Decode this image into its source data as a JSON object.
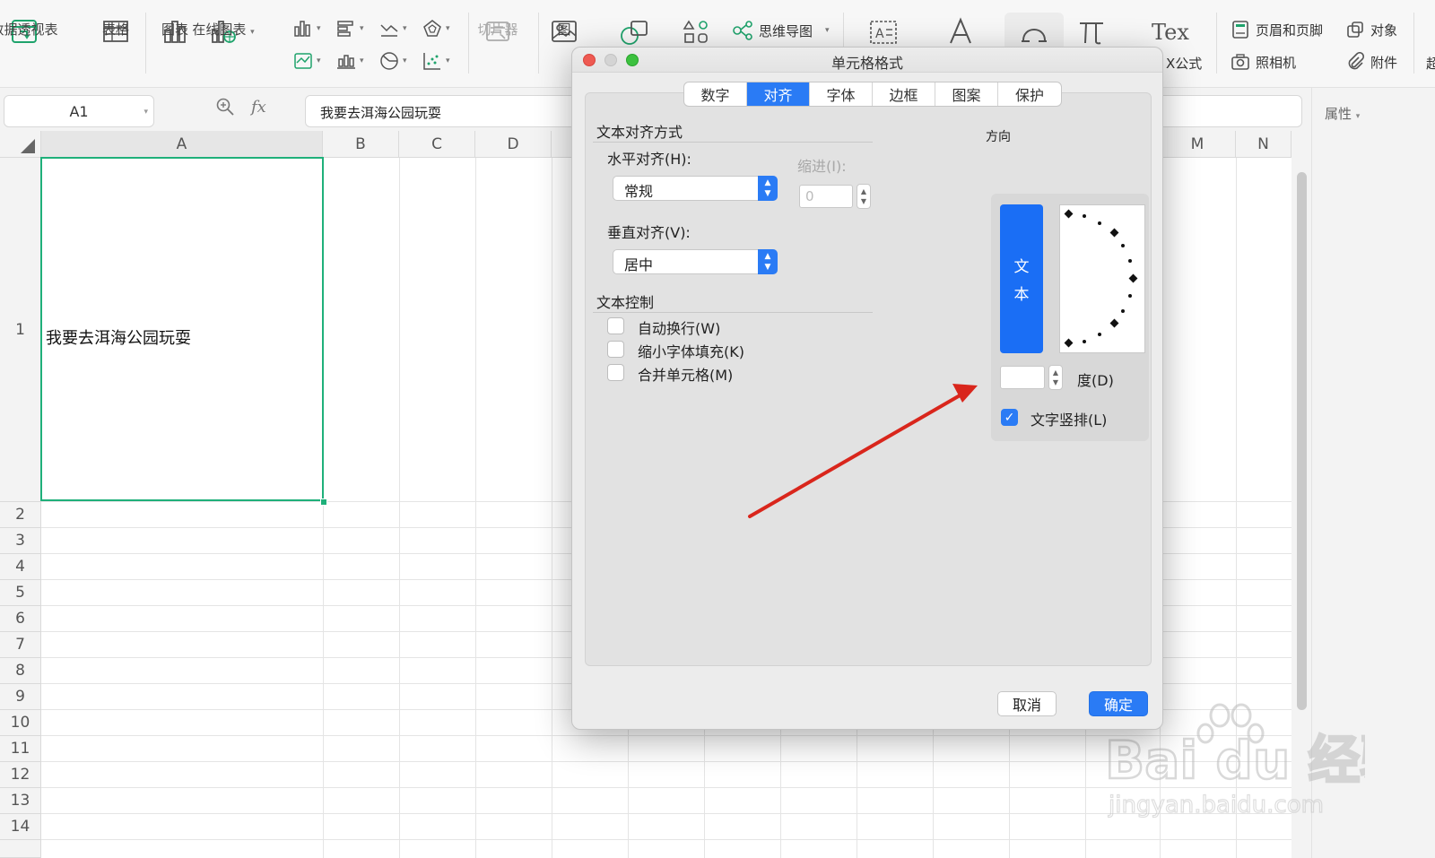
{
  "toolbar": {
    "pivot_table": "数据透视表",
    "table": "表格",
    "chart": "图表",
    "online_chart": "在线图表",
    "slicer": "切片器",
    "picture_partial": "图",
    "mind_map": "思维导图",
    "latex_partial": "X公式",
    "header_footer": "页眉和页脚",
    "object": "对象",
    "camera": "照相机",
    "attachment": "附件",
    "cut_off": "超"
  },
  "formula_bar": {
    "cell_ref": "A1",
    "fx": "fx",
    "content": "我要去洱海公园玩耍"
  },
  "properties_panel": {
    "title": "属性"
  },
  "sheet": {
    "columns": [
      "A",
      "B",
      "C",
      "D",
      "M",
      "N"
    ],
    "rows": [
      "1",
      "2",
      "3",
      "4",
      "5",
      "6",
      "7",
      "8",
      "9",
      "10",
      "11",
      "12",
      "13",
      "14"
    ],
    "a1_value": "我要去洱海公园玩耍"
  },
  "dialog": {
    "title": "单元格格式",
    "tabs": [
      "数字",
      "对齐",
      "字体",
      "边框",
      "图案",
      "保护"
    ],
    "active_tab": "对齐",
    "text_alignment_section": "文本对齐方式",
    "horizontal_label": "水平对齐(H):",
    "horizontal_value": "常规",
    "indent_label": "缩进(I):",
    "indent_value": "0",
    "vertical_label": "垂直对齐(V):",
    "vertical_value": "居中",
    "text_control_section": "文本控制",
    "wrap_text": "自动换行(W)",
    "shrink_to_fit": "缩小字体填充(K)",
    "merge_cells": "合并单元格(M)",
    "orientation_section": "方向",
    "vertical_text_char1": "文",
    "vertical_text_char2": "本",
    "degree_label": "度(D)",
    "vertical_text_checkbox": "文字竖排(L)",
    "vertical_text_checked": true,
    "cancel_button": "取消",
    "ok_button": "确定"
  },
  "watermark": {
    "brand": "Bai du 经验",
    "url": "jingyan.baidu.com"
  },
  "colors": {
    "accent_blue": "#2a7bf5",
    "selection_green": "#1fb07a",
    "arrow_red": "#d9261c"
  }
}
